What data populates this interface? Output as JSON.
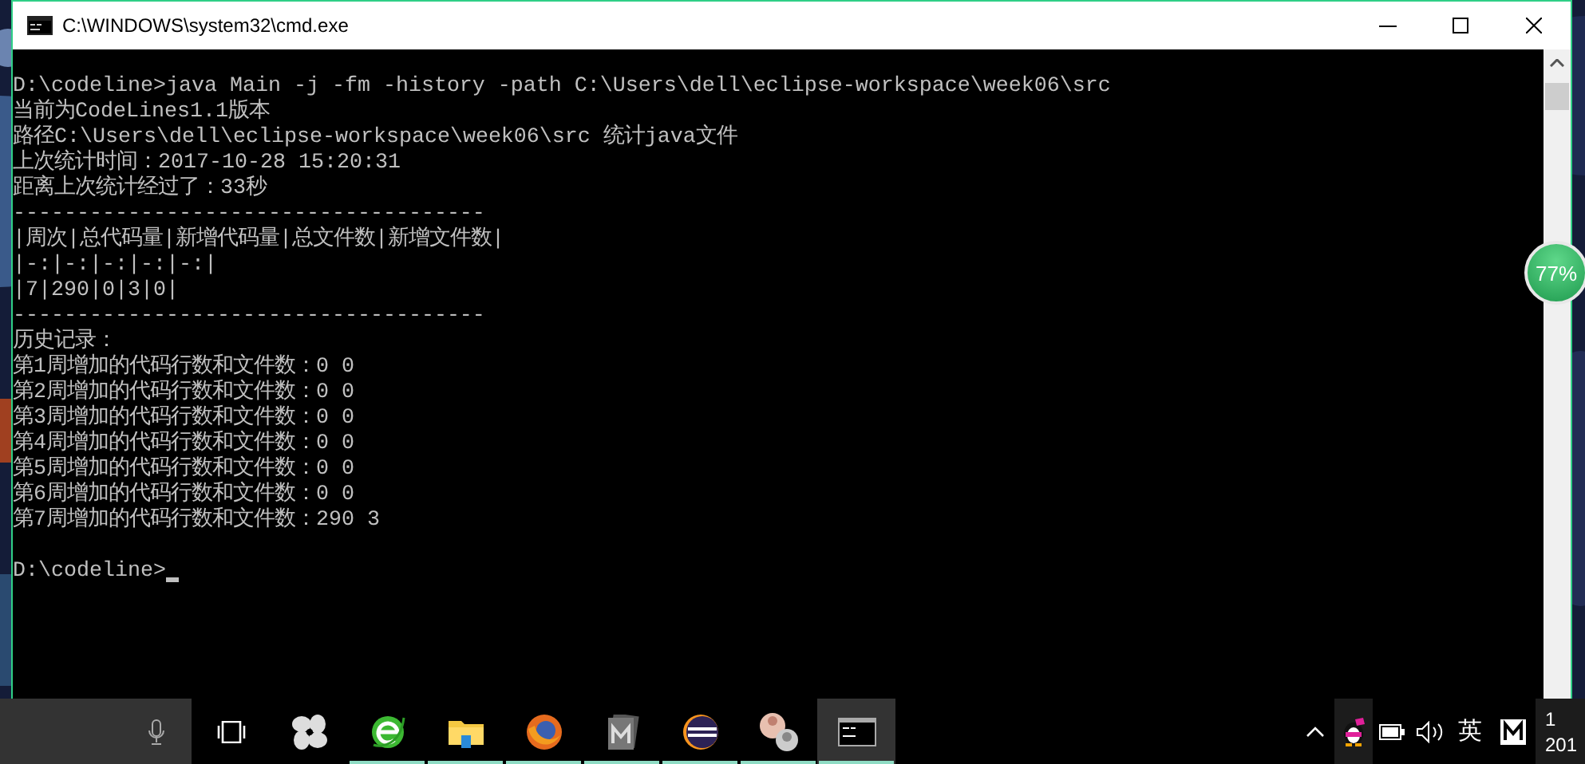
{
  "window": {
    "title": "C:\\WINDOWS\\system32\\cmd.exe"
  },
  "console": {
    "lines": [
      "D:\\codeline>java Main -j -fm -history -path C:\\Users\\dell\\eclipse-workspace\\week06\\src",
      "当前为CodeLines1.1版本",
      "路径C:\\Users\\dell\\eclipse-workspace\\week06\\src 统计java文件",
      "上次统计时间：2017-10-28 15:20:31",
      "距离上次统计经过了：33秒",
      "-------------------------------------",
      "|周次|总代码量|新增代码量|总文件数|新增文件数|",
      "|-:|-:|-:|-:|-:|",
      "|7|290|0|3|0|",
      "-------------------------------------",
      "历史记录：",
      "第1周增加的代码行数和文件数：0 0",
      "第2周增加的代码行数和文件数：0 0",
      "第3周增加的代码行数和文件数：0 0",
      "第4周增加的代码行数和文件数：0 0",
      "第5周增加的代码行数和文件数：0 0",
      "第6周增加的代码行数和文件数：0 0",
      "第7周增加的代码行数和文件数：290 3"
    ],
    "prompt": "D:\\codeline>",
    "cursor": true
  },
  "floating_badge": {
    "text": "77%"
  },
  "taskbar": {
    "apps": [
      {
        "kind": "task-view",
        "running": false,
        "active": false
      },
      {
        "kind": "pinwheel",
        "running": false,
        "active": false
      },
      {
        "kind": "browser",
        "running": true,
        "active": false
      },
      {
        "kind": "folder",
        "running": true,
        "active": false
      },
      {
        "kind": "firefox",
        "running": true,
        "active": false
      },
      {
        "kind": "documents",
        "running": true,
        "active": false
      },
      {
        "kind": "eclipse",
        "running": true,
        "active": false
      },
      {
        "kind": "avatar",
        "running": true,
        "active": false
      },
      {
        "kind": "terminal",
        "running": true,
        "active": true
      }
    ],
    "tray": {
      "language": "英",
      "clock": [
        "1",
        "201"
      ]
    }
  }
}
